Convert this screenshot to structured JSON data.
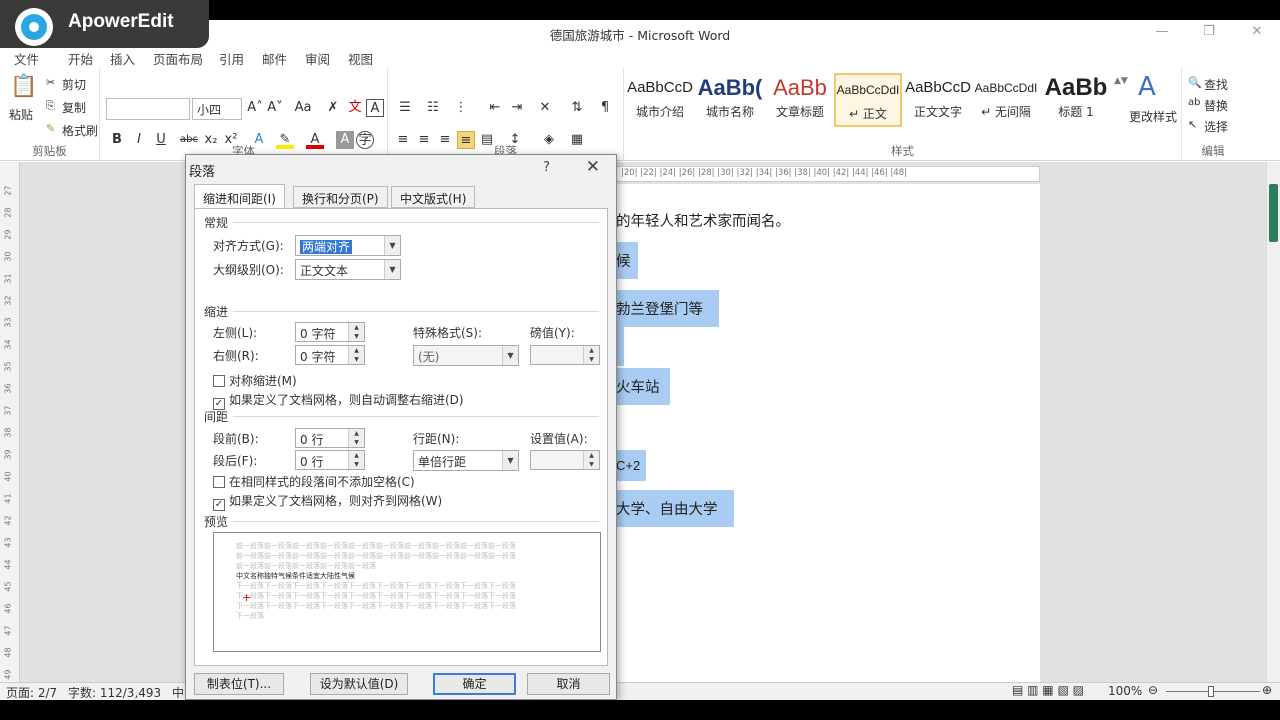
{
  "watermark": {
    "text": "ApowerEdit"
  },
  "window": {
    "title": "德国旅游城市 - Microsoft Word"
  },
  "tabs": [
    "文件",
    "开始",
    "插入",
    "页面布局",
    "引用",
    "邮件",
    "审阅",
    "视图"
  ],
  "ribbon": {
    "clipboard": {
      "paste": "粘贴",
      "cut": "剪切",
      "copy": "复制",
      "format_painter": "格式刷",
      "label": "剪贴板"
    },
    "font": {
      "size": "小四",
      "label": "字体"
    },
    "paragraph": {
      "label": "段落"
    },
    "styles": {
      "label": "样式",
      "items": [
        {
          "sample": "AaBbCcD",
          "name": "城市介绍"
        },
        {
          "sample": "AaBb(",
          "name": "城市名称"
        },
        {
          "sample": "AaBb",
          "name": "文章标题"
        },
        {
          "sample": "AaBbCcDdI",
          "name": "↵ 正文"
        },
        {
          "sample": "AaBbCcD",
          "name": "正文文字"
        },
        {
          "sample": "AaBbCcDdI",
          "name": "↵ 无间隔"
        },
        {
          "sample": "AaBb",
          "name": "标题 1"
        }
      ],
      "change_styles": "更改样式"
    },
    "editing": {
      "find": "查找",
      "replace": "替换",
      "select": "选择",
      "label": "编辑"
    }
  },
  "document": {
    "ruler": "|20| |22| |24| |26| |28| |30| |32| |34| |36| |38| |40| |42| |44| |46| |48|",
    "line1": "的年轻人和艺术家而闻名。",
    "highlights": [
      "候",
      "勃兰登堡门等",
      "火车站",
      "C+2",
      "大学、自由大学"
    ]
  },
  "status": {
    "page": "页面: 2/7",
    "words": "字数: 112/3,493",
    "lang": "中",
    "zoom": "100%"
  },
  "dialog": {
    "title": "段落",
    "help": "?",
    "tabs": [
      "缩进和间距(I)",
      "换行和分页(P)",
      "中文版式(H)"
    ],
    "general": {
      "section": "常规",
      "alignment_label": "对齐方式(G):",
      "alignment_value": "两端对齐",
      "outline_label": "大纲级别(O):",
      "outline_value": "正文文本"
    },
    "indent": {
      "section": "缩进",
      "left_label": "左侧(L):",
      "left_value": "0 字符",
      "right_label": "右侧(R):",
      "right_value": "0 字符",
      "special_label": "特殊格式(S):",
      "special_value": "(无)",
      "by_label": "磅值(Y):",
      "mirror": "对称缩进(M)",
      "auto_adjust": "如果定义了文档网格，则自动调整右缩进(D)"
    },
    "spacing": {
      "section": "间距",
      "before_label": "段前(B):",
      "before_value": "0 行",
      "after_label": "段后(F):",
      "after_value": "0 行",
      "line_label": "行距(N):",
      "line_value": "单倍行距",
      "at_label": "设置值(A):",
      "no_space": "在相同样式的段落间不添加空格(C)",
      "snap_grid": "如果定义了文档网格，则对齐到网格(W)"
    },
    "preview": {
      "section": "预览",
      "prev_text": "前一段落前一段落前一段落前一段落前一段落前一段落前一段落前一段落前一段落前一段落",
      "prev_text_end": "前一段落前一段落前一段落前一段落前一段落",
      "sample_text": "中文名称独特气候条件适宜大陆性气候",
      "next_text": "下一段落下一段落下一段落下一段落下一段落下一段落下一段落下一段落下一段落下一段落",
      "next_text_end": "下一段落"
    },
    "buttons": {
      "tabs": "制表位(T)...",
      "set_default": "设为默认值(D)",
      "ok": "确定",
      "cancel": "取消"
    }
  }
}
